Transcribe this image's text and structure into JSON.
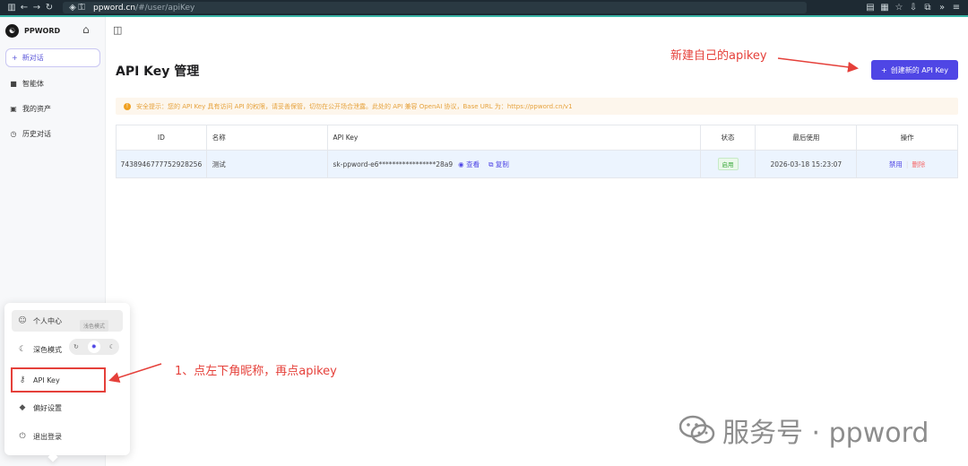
{
  "browser": {
    "url_domain": "ppword.cn",
    "url_path": "/#/user/apiKey"
  },
  "sidebar": {
    "logo_text": "PPWORD",
    "new_chat_label": "新对话",
    "items": [
      {
        "label": "智能体",
        "icon": "bag-icon"
      },
      {
        "label": "我的资产",
        "icon": "asset-icon"
      },
      {
        "label": "历史对话",
        "icon": "clock-icon"
      }
    ]
  },
  "main": {
    "title": "API Key 管理",
    "create_button_label": "创建新的 API Key",
    "notice": "安全提示：您的 API Key 具有访问 API 的权限，请妥善保管，切勿在公开场合泄露。此处的 API 兼容 OpenAI 协议，Base URL 为：https://ppword.cn/v1",
    "table": {
      "headers": [
        "ID",
        "名称",
        "API Key",
        "状态",
        "最后使用",
        "操作"
      ],
      "rows": [
        {
          "id": "7438946777752928256",
          "name": "测试",
          "api_key": "sk-ppword-e6*****************28a9",
          "view_label": "查看",
          "copy_label": "复制",
          "status": "启用",
          "last_used": "2026-03-18 15:23:07",
          "op_disable": "禁用",
          "op_delete": "删除"
        }
      ]
    }
  },
  "popup": {
    "profile_label": "个人中心",
    "dark_mode_label": "深色模式",
    "tooltip": "浅色模式",
    "api_key_label": "API Key",
    "prefs_label": "偏好设置",
    "logout_label": "退出登录"
  },
  "annotations": {
    "top": "新建自己的apikey",
    "bottom": "1、点左下角昵称，再点apikey"
  },
  "watermark": {
    "text": "服务号 · ppword"
  },
  "colors": {
    "accent": "#4f46e5",
    "annotation": "#e5403a",
    "notice_text": "#e6a23c"
  }
}
